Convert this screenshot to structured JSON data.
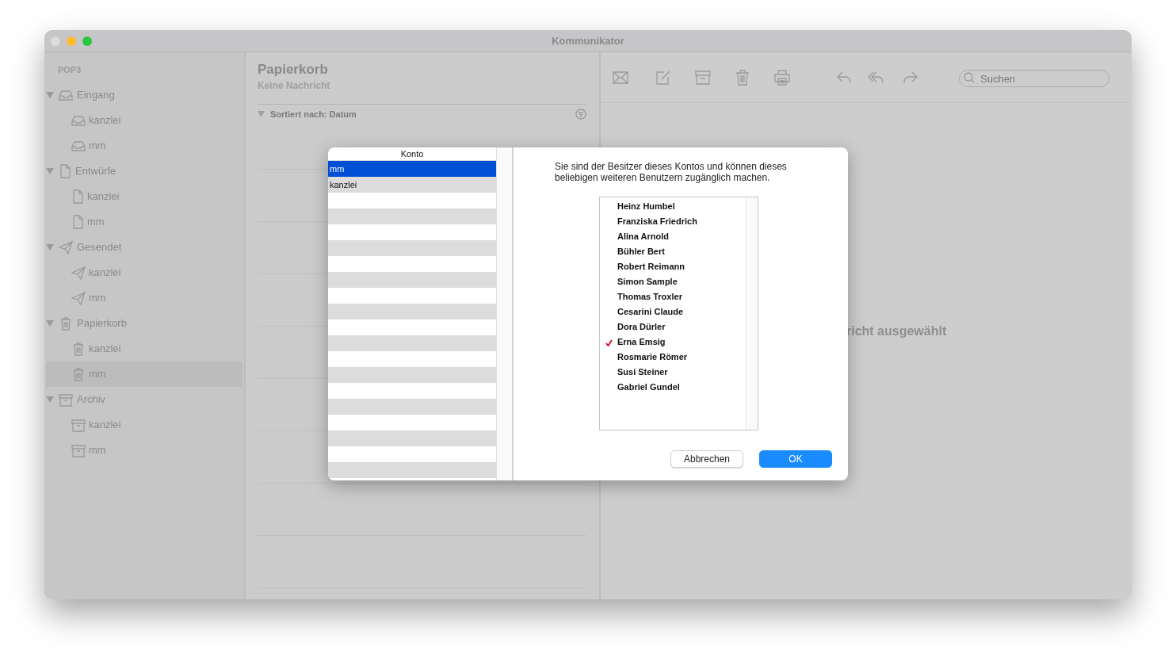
{
  "window": {
    "title": "Kommunikator"
  },
  "sidebar": {
    "heading": "POP3",
    "groups": [
      {
        "label": "Eingang",
        "kind": "inbox",
        "expanded": true,
        "children": [
          {
            "label": "kanzlei",
            "selected": false
          },
          {
            "label": "mm",
            "selected": false
          }
        ]
      },
      {
        "label": "Entwürfe",
        "kind": "drafts",
        "expanded": true,
        "children": [
          {
            "label": "kanzlei",
            "selected": false
          },
          {
            "label": "mm",
            "selected": false
          }
        ]
      },
      {
        "label": "Gesendet",
        "kind": "sent",
        "expanded": true,
        "children": [
          {
            "label": "kanzlei",
            "selected": false
          },
          {
            "label": "mm",
            "selected": false
          }
        ]
      },
      {
        "label": "Papierkorb",
        "kind": "trash",
        "expanded": true,
        "children": [
          {
            "label": "kanzlei",
            "selected": false
          },
          {
            "label": "mm",
            "selected": true
          }
        ]
      },
      {
        "label": "Archiv",
        "kind": "archive",
        "expanded": true,
        "children": [
          {
            "label": "kanzlei",
            "selected": false
          },
          {
            "label": "mm",
            "selected": false
          }
        ]
      }
    ]
  },
  "message_list": {
    "title": "Papierkorb",
    "subtitle": "Keine Nachricht",
    "sort_label": "Sortiert nach: Datum"
  },
  "toolbar": {
    "search": {
      "placeholder": "Suchen"
    }
  },
  "detail": {
    "empty_text": "richt ausgewählt"
  },
  "dialog": {
    "accounts": {
      "column": "Konto",
      "rows": [
        {
          "label": "mm",
          "selected": true
        },
        {
          "label": "kanzlei",
          "selected": false
        }
      ]
    },
    "message": "Sie sind der Besitzer dieses Kontos und können dieses beliebigen weiteren Benutzern zugänglich machen.",
    "users": [
      {
        "name": "Heinz Humbel",
        "checked": false
      },
      {
        "name": "Franziska Friedrich",
        "checked": false
      },
      {
        "name": "Alina Arnold",
        "checked": false
      },
      {
        "name": "Bühler Bert",
        "checked": false
      },
      {
        "name": "Robert Reimann",
        "checked": false
      },
      {
        "name": "Simon Sample",
        "checked": false
      },
      {
        "name": "Thomas Troxler",
        "checked": false
      },
      {
        "name": "Cesarini Claude",
        "checked": false
      },
      {
        "name": "Dora Dürler",
        "checked": false
      },
      {
        "name": "Erna Emsig",
        "checked": true
      },
      {
        "name": "Rosmarie Römer",
        "checked": false
      },
      {
        "name": "Susi Steiner",
        "checked": false
      },
      {
        "name": "Gabriel Gundel",
        "checked": false
      }
    ],
    "buttons": [
      {
        "label": "Abbrechen",
        "kind": "secondary"
      },
      {
        "label": "OK",
        "kind": "primary"
      }
    ]
  }
}
